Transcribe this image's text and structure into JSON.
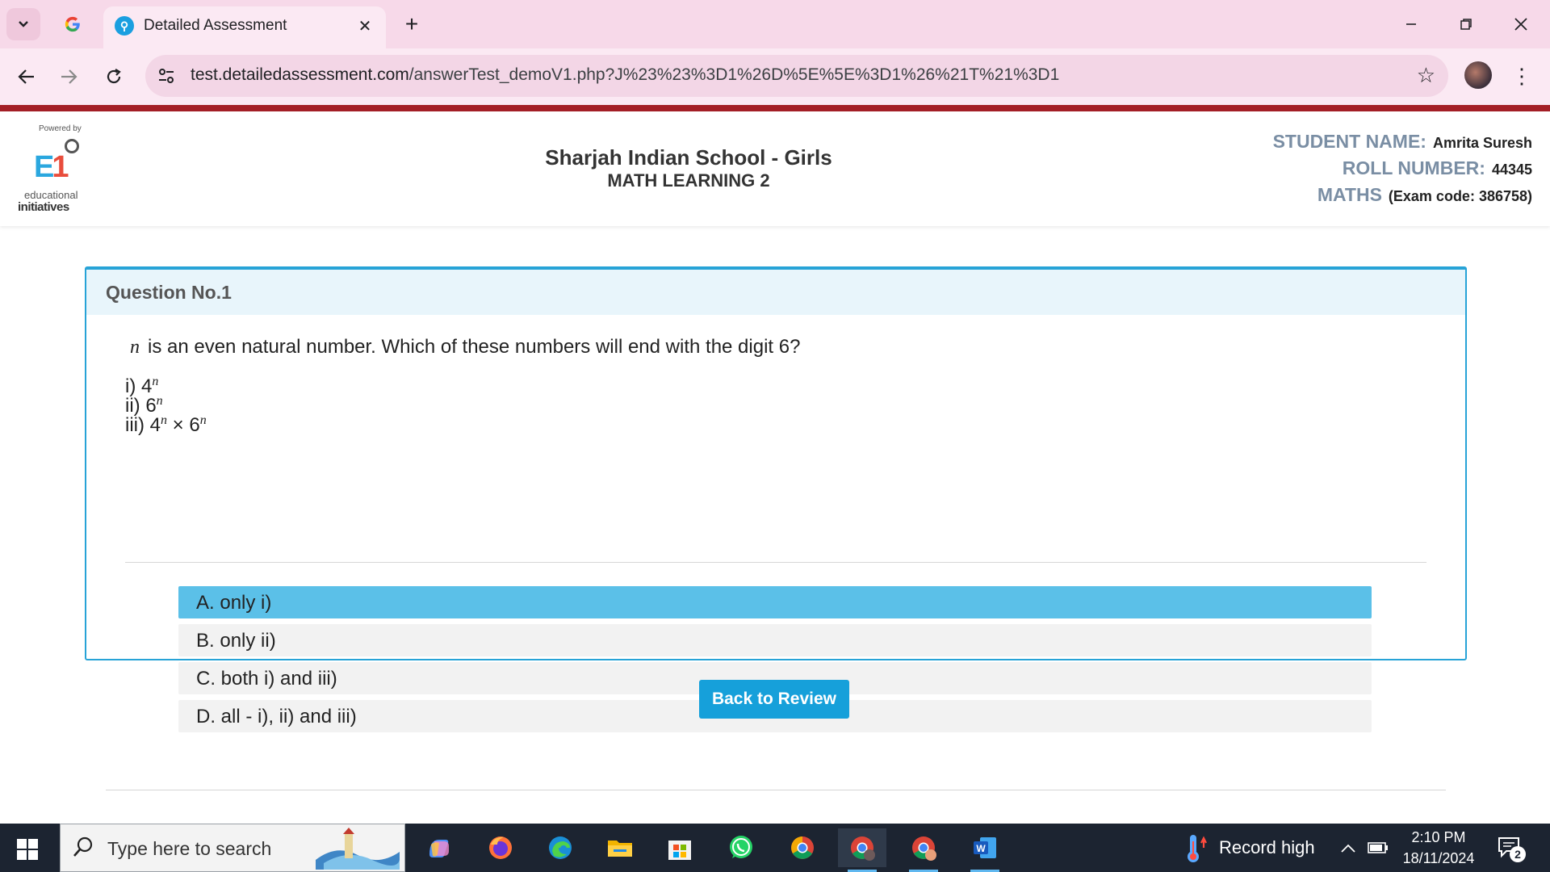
{
  "browser": {
    "tab_title": "Detailed Assessment",
    "url_domain": "test.detailedassessment.com",
    "url_path": "/answerTest_demoV1.php?J%23%23%3D1%26D%5E%5E%3D1%26%21T%21%3D1"
  },
  "header": {
    "logo_powered": "Powered by",
    "logo_educational": "educational",
    "logo_initiatives": "initiatives",
    "school_name": "Sharjah Indian School - Girls",
    "test_name": "MATH LEARNING 2",
    "student_label": "STUDENT NAME:",
    "student_name": "Amrita Suresh",
    "roll_label": "ROLL NUMBER:",
    "roll_number": "44345",
    "subject_label": "MATHS",
    "exam_code": "(Exam code: 386758)"
  },
  "question": {
    "heading": "Question No.1",
    "variable": "n",
    "text": "is an even natural number. Which of these numbers will end with the digit 6?",
    "statements": [
      {
        "prefix": "i) 4",
        "exp": "n",
        "mid": "",
        "exp2": ""
      },
      {
        "prefix": "ii) 6",
        "exp": "n",
        "mid": "",
        "exp2": ""
      },
      {
        "prefix": "iii) 4",
        "exp": "n",
        "mid": " × 6",
        "exp2": "n"
      }
    ],
    "options": [
      {
        "label": "A. only i)",
        "selected": true
      },
      {
        "label": "B. only ii)",
        "selected": false
      },
      {
        "label": "C. both i) and iii)",
        "selected": false
      },
      {
        "label": "D. all - i), ii) and iii)",
        "selected": false
      }
    ]
  },
  "actions": {
    "back_label": "Back to Review"
  },
  "taskbar": {
    "search_placeholder": "Type here to search",
    "weather_text": "Record high",
    "time": "2:10 PM",
    "date": "18/11/2024",
    "notification_count": "2",
    "apps": [
      "copilot-icon",
      "firefox-icon",
      "edge-icon",
      "file-explorer-icon",
      "microsoft-store-icon",
      "whatsapp-icon",
      "chrome-icon",
      "chrome-profile-icon",
      "chrome-profile2-icon",
      "word-icon"
    ]
  },
  "colors": {
    "accent": "#16a0da",
    "selected_option": "#5bc0e8",
    "header_bar": "#a41f26",
    "label_gray": "#7a8ea4"
  }
}
